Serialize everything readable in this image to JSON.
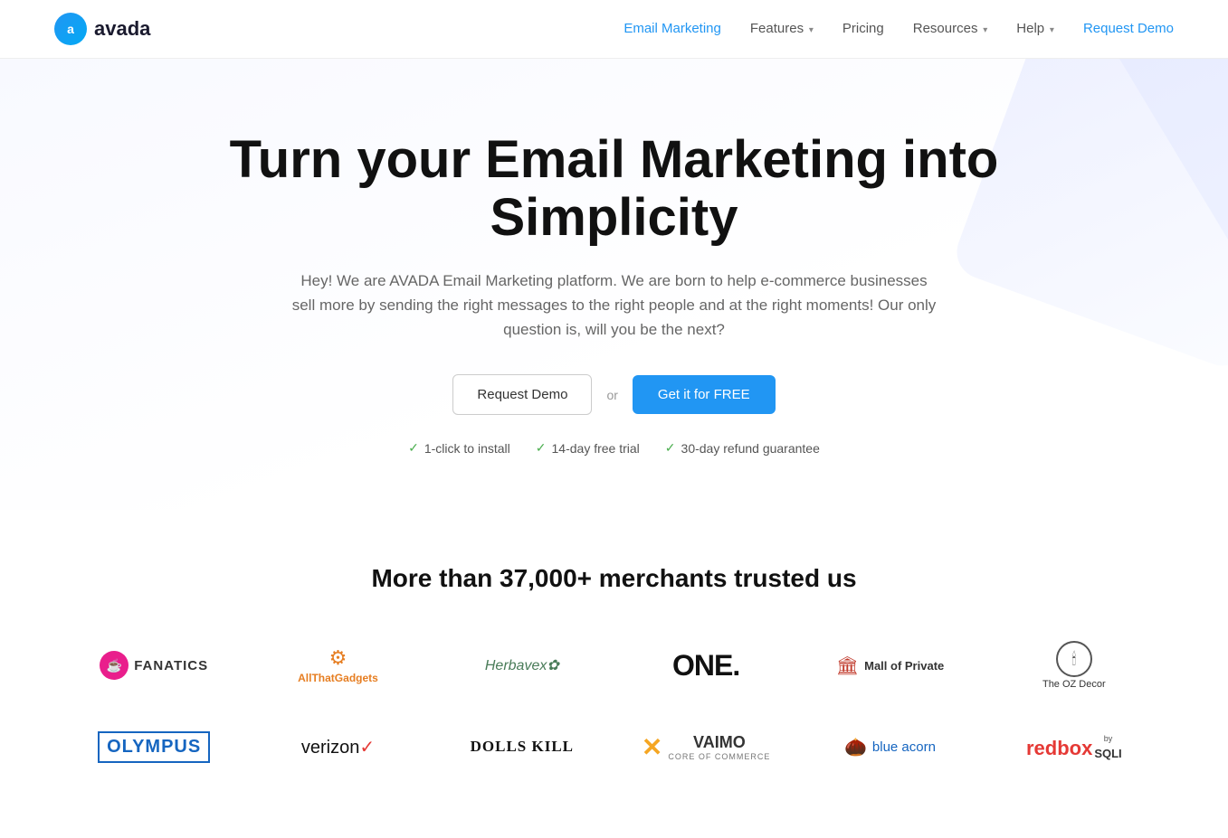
{
  "brand": {
    "logo_letter": "a",
    "name": "avada"
  },
  "nav": {
    "links": [
      {
        "id": "email-marketing",
        "label": "Email Marketing",
        "active": true,
        "dropdown": false,
        "cta": false
      },
      {
        "id": "features",
        "label": "Features",
        "active": false,
        "dropdown": true,
        "cta": false
      },
      {
        "id": "pricing",
        "label": "Pricing",
        "active": false,
        "dropdown": false,
        "cta": false
      },
      {
        "id": "resources",
        "label": "Resources",
        "active": false,
        "dropdown": true,
        "cta": false
      },
      {
        "id": "help",
        "label": "Help",
        "active": false,
        "dropdown": true,
        "cta": false
      },
      {
        "id": "request-demo",
        "label": "Request Demo",
        "active": false,
        "dropdown": false,
        "cta": true
      }
    ]
  },
  "hero": {
    "headline": "Turn your Email Marketing into Simplicity",
    "subheadline": "Hey! We are AVADA Email Marketing platform. We are born to help e-commerce businesses sell more by sending the right messages to the right people and at the right moments! Our only question is, will you be the next?",
    "btn_demo": "Request Demo",
    "btn_or": "or",
    "btn_free": "Get it for FREE",
    "check1": "1-click to install",
    "check2": "14-day free trial",
    "check3": "30-day refund guarantee"
  },
  "trusted": {
    "heading": "More than 37,000+ merchants trusted us",
    "brands_row1": [
      {
        "id": "fanatics",
        "name": "Fanatics"
      },
      {
        "id": "allthatgadgets",
        "name": "AllThatGadgets"
      },
      {
        "id": "herbavex",
        "name": "Herbavex"
      },
      {
        "id": "one",
        "name": "ONE."
      },
      {
        "id": "mallofprivate",
        "name": "Mall of Private"
      },
      {
        "id": "ozdecor",
        "name": "The OZ Decor"
      }
    ],
    "brands_row2": [
      {
        "id": "olympus",
        "name": "OLYMPUS"
      },
      {
        "id": "verizon",
        "name": "verizon"
      },
      {
        "id": "dollskill",
        "name": "DOLLS KILL"
      },
      {
        "id": "vaimo",
        "name": "VAIMO"
      },
      {
        "id": "blueacorn",
        "name": "blue acorn"
      },
      {
        "id": "redbox",
        "name": "redbox by SQLI"
      }
    ]
  }
}
